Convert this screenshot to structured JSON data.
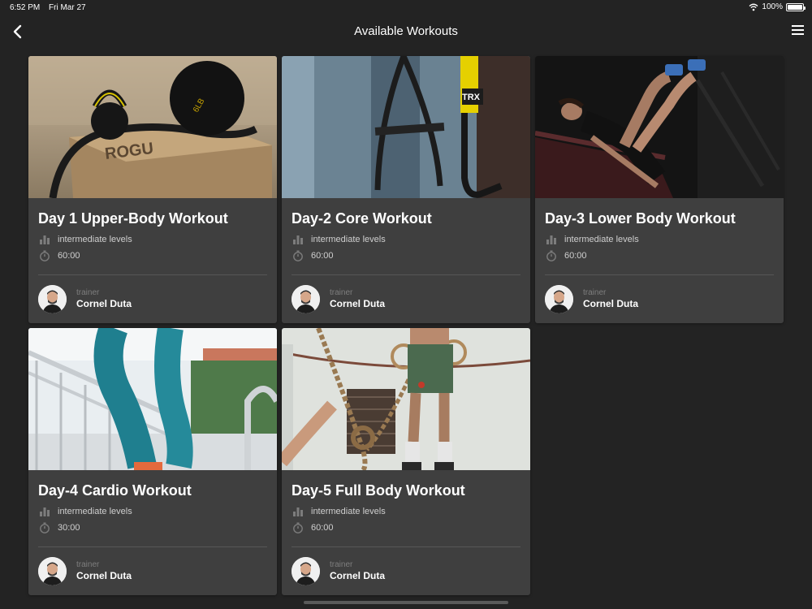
{
  "status": {
    "time": "6:52 PM",
    "date": "Fri Mar 27",
    "battery": "100%"
  },
  "nav": {
    "title": "Available Workouts"
  },
  "trainer_label": "trainer",
  "workouts": [
    {
      "title": "Day 1 Upper-Body Workout",
      "level": "intermediate levels",
      "duration": "60:00",
      "trainer": "Cornel Duta",
      "image": "kettlebell-box-photo"
    },
    {
      "title": "Day-2 Core Workout",
      "level": "intermediate levels",
      "duration": "60:00",
      "trainer": "Cornel Duta",
      "image": "trx-straps-photo"
    },
    {
      "title": "Day-3 Lower Body Workout",
      "level": "intermediate levels",
      "duration": "60:00",
      "trainer": "Cornel Duta",
      "image": "leg-press-photo"
    },
    {
      "title": "Day-4 Cardio Workout",
      "level": "intermediate levels",
      "duration": "30:00",
      "trainer": "Cornel Duta",
      "image": "stairs-runner-photo"
    },
    {
      "title": "Day-5 Full Body Workout",
      "level": "intermediate levels",
      "duration": "60:00",
      "trainer": "Cornel Duta",
      "image": "gym-rings-photo"
    }
  ]
}
